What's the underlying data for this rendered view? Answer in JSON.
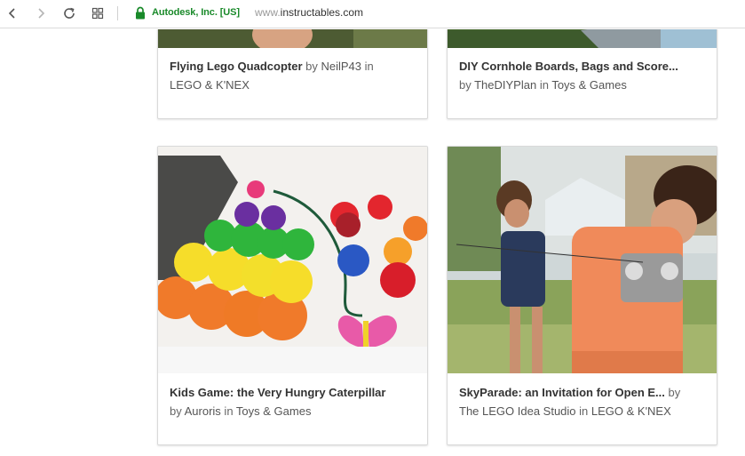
{
  "browser": {
    "org_label": "Autodesk, Inc. [US]",
    "url_prefix": "www.",
    "url_host": "instructables.com",
    "icons": [
      "back-icon",
      "forward-icon",
      "reload-icon",
      "tabs-grid-icon",
      "lock-icon"
    ]
  },
  "colors": {
    "secure_green": "#1a8a2a",
    "title_text": "#333333",
    "meta_text": "#666666",
    "card_border": "#d9d9d9"
  },
  "cards": [
    {
      "title": "Flying Lego Quadcopter",
      "by": " by ",
      "author": "NeilP43",
      "in": " in ",
      "category": "LEGO & K'NEX"
    },
    {
      "title": "DIY Cornhole Boards, Bags and Score...",
      "by": "by ",
      "author": "TheDIYPlan",
      "in": " in ",
      "category": "Toys & Games"
    },
    {
      "title": "Kids Game: the Very Hungry Caterpillar",
      "by": "by ",
      "author": "Auroris",
      "in": " in ",
      "category": "Toys & Games"
    },
    {
      "title": "SkyParade: an Invitation for Open E...",
      "by": " by ",
      "author": "The LEGO Idea Studio",
      "in": " in ",
      "category": "LEGO & K'NEX"
    }
  ]
}
